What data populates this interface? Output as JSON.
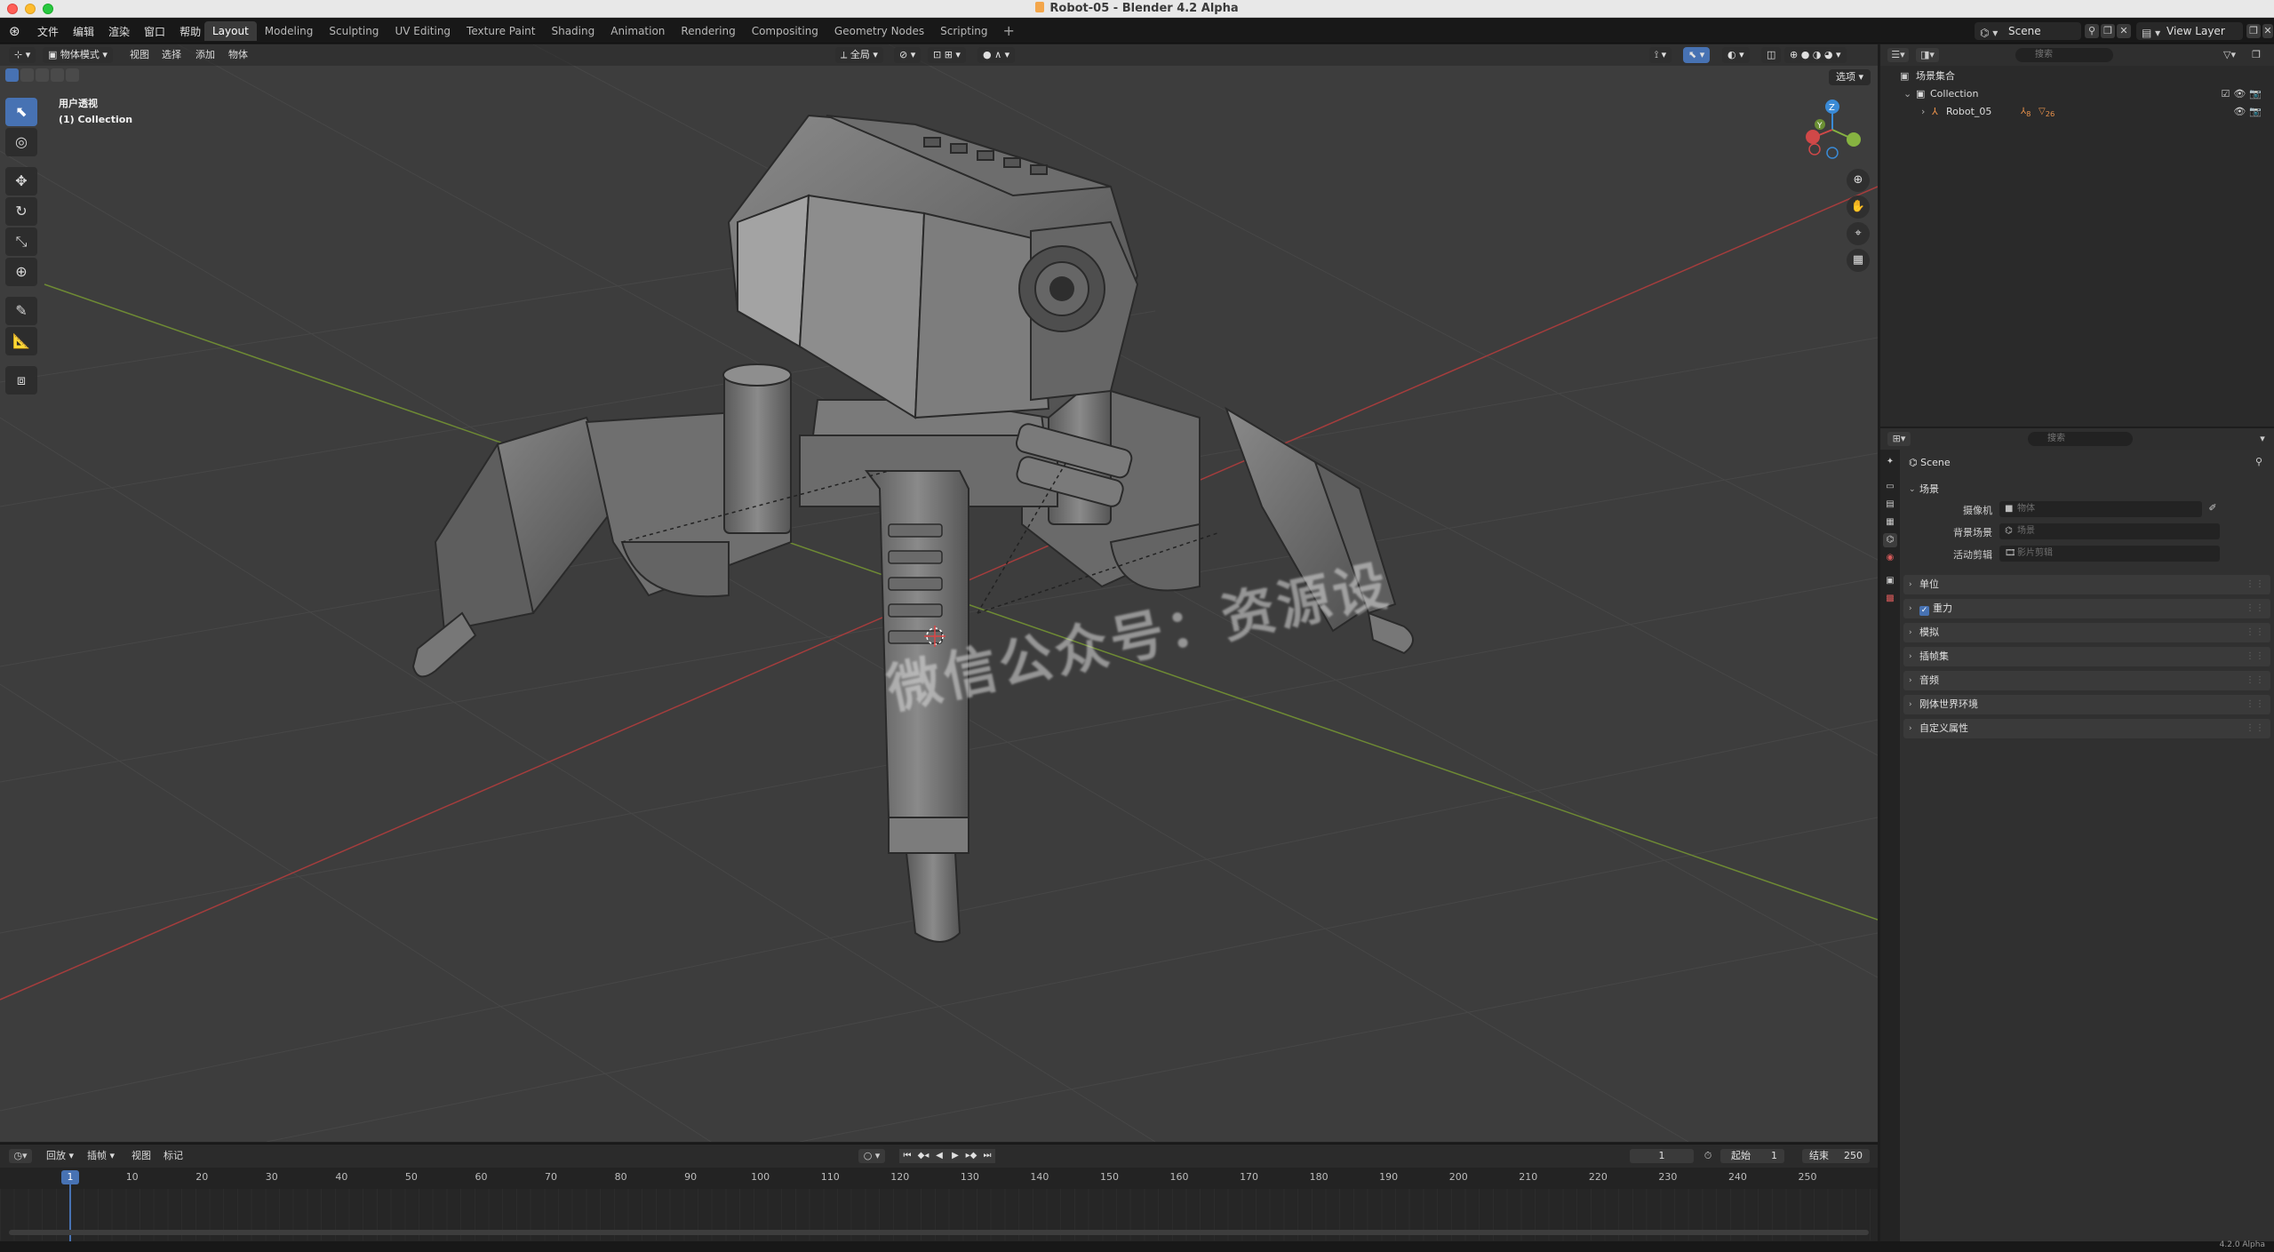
{
  "window": {
    "title": "Robot-05 - Blender 4.2 Alpha"
  },
  "menu": [
    "文件",
    "编辑",
    "渲染",
    "窗口",
    "帮助"
  ],
  "workspaces": [
    "Layout",
    "Modeling",
    "Sculpting",
    "UV Editing",
    "Texture Paint",
    "Shading",
    "Animation",
    "Rendering",
    "Compositing",
    "Geometry Nodes",
    "Scripting"
  ],
  "active_workspace": "Layout",
  "scene_selector": "Scene",
  "view_layer_selector": "View Layer",
  "viewport": {
    "mode": "物体模式",
    "menus": [
      "视图",
      "选择",
      "添加",
      "物体"
    ],
    "transform_orientation": "全局",
    "options_label": "选项",
    "info_line1": "用户透视",
    "info_line2": "(1) Collection",
    "watermark": "微信公众号：资源设"
  },
  "outliner": {
    "search_placeholder": "搜索",
    "rows": [
      {
        "label": "场景集合"
      },
      {
        "label": "Collection"
      },
      {
        "label": "Robot_05"
      }
    ],
    "robot_badges": [
      "8",
      "26"
    ]
  },
  "properties": {
    "search_placeholder": "搜索",
    "context": "Scene",
    "scene_panel": "场景",
    "fields": [
      {
        "label": "摄像机",
        "placeholder": "物体"
      },
      {
        "label": "背景场景",
        "placeholder": "场景"
      },
      {
        "label": "活动剪辑",
        "placeholder": "影片剪辑"
      }
    ],
    "panels": [
      "单位",
      "重力",
      "模拟",
      "插帧集",
      "音频",
      "刚体世界环境",
      "自定义属性"
    ]
  },
  "timeline": {
    "menus": [
      "回放",
      "插帧",
      "视图",
      "标记"
    ],
    "current_frame": "1",
    "start_label": "起始",
    "start": "1",
    "end_label": "结束",
    "end": "250",
    "ticks": [
      "10",
      "20",
      "30",
      "40",
      "50",
      "60",
      "70",
      "80",
      "90",
      "100",
      "110",
      "120",
      "130",
      "140",
      "150",
      "160",
      "170",
      "180",
      "190",
      "200",
      "210",
      "220",
      "230",
      "240",
      "250"
    ],
    "cursor_frame": "1"
  },
  "status": {
    "version": "4.2.0 Alpha"
  },
  "colors": {
    "accent": "#4772b3",
    "x_axis": "#d04848",
    "y_axis": "#86b341",
    "z_axis": "#3a8ad6"
  }
}
